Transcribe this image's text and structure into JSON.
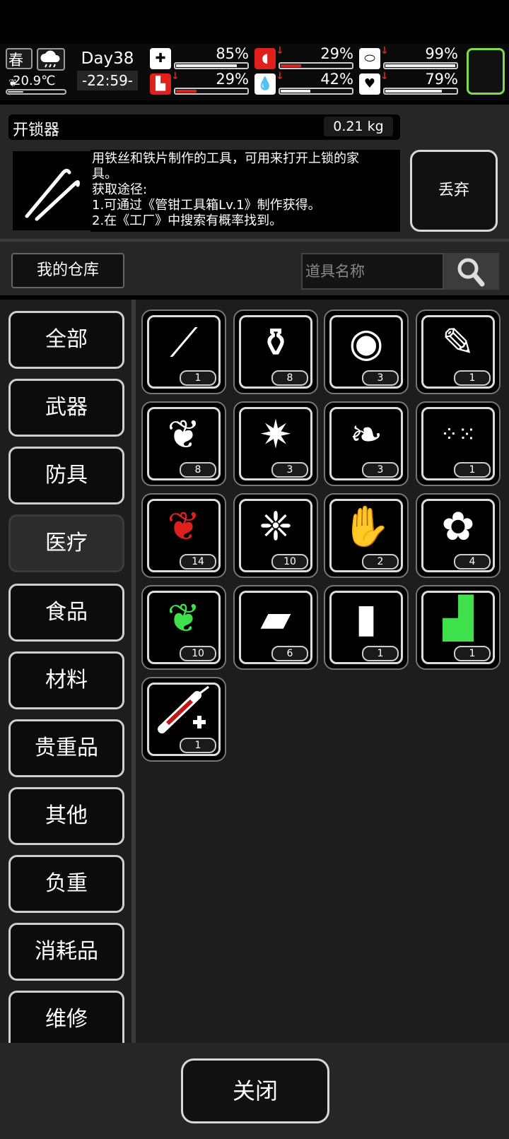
{
  "status": {
    "season": "春",
    "weather_icon": "rain-cloud-icon",
    "temperature": "20.9℃",
    "day": "Day38",
    "time": "-22:59-",
    "stats": [
      {
        "icon": "medkit-icon",
        "value": "85%",
        "fill": 0.85,
        "down": false
      },
      {
        "icon": "stomach-icon",
        "value": "29%",
        "fill": 0.29,
        "down": true
      },
      {
        "icon": "pill-icon",
        "value": "99%",
        "fill": 0.99,
        "down": true
      },
      {
        "icon": "leg-icon",
        "value": "29%",
        "fill": 0.29,
        "down": true
      },
      {
        "icon": "water-drop-icon",
        "value": "42%",
        "fill": 0.42,
        "down": true
      },
      {
        "icon": "heart-icon",
        "value": "79%",
        "fill": 0.79,
        "down": true
      }
    ]
  },
  "item": {
    "name": "开锁器",
    "weight": "0.21 kg",
    "icon": "lockpick-icon",
    "desc_lines": [
      "用铁丝和铁片制作的工具，可用来打开上锁的家",
      "具。",
      "获取途径:",
      "1.可通过《管钳工具箱Lv.1》制作获得。",
      "2.在《工厂》中搜索有概率找到。"
    ],
    "discard_label": "丢弃"
  },
  "warehouse_label": "我的仓库",
  "search_placeholder": "道具名称",
  "categories": [
    "全部",
    "武器",
    "防具",
    "医疗",
    "食品",
    "材料",
    "贵重品",
    "其他",
    "负重",
    "消耗品",
    "维修"
  ],
  "selected_category": "医疗",
  "items": [
    {
      "icon": "bandage-roll-icon",
      "count": "1"
    },
    {
      "icon": "pill-bottle-icon",
      "count": "8"
    },
    {
      "icon": "lemon-slice-icon",
      "count": "3"
    },
    {
      "icon": "test-tube-icon",
      "count": "1"
    },
    {
      "icon": "herb-plant-icon",
      "count": "8"
    },
    {
      "icon": "star-flower-icon",
      "count": "3"
    },
    {
      "icon": "leaf-icon",
      "count": "3"
    },
    {
      "icon": "seeds-icon",
      "count": "1"
    },
    {
      "icon": "red-mint-icon",
      "count": "14"
    },
    {
      "icon": "mint-leaf-icon",
      "count": "10"
    },
    {
      "icon": "ginger-root-icon",
      "count": "2"
    },
    {
      "icon": "berry-branch-icon",
      "count": "4"
    },
    {
      "icon": "green-mint-icon",
      "count": "10"
    },
    {
      "icon": "bandage-icon",
      "count": "6"
    },
    {
      "icon": "medicine-jar-icon",
      "count": "1"
    },
    {
      "icon": "green-drink-icon",
      "count": "1"
    },
    {
      "icon": "syringe-icon",
      "count": "1"
    }
  ],
  "close_label": "关闭",
  "colors": {
    "accent_green": "#7fdb4b",
    "alert_red": "#e0201d"
  }
}
